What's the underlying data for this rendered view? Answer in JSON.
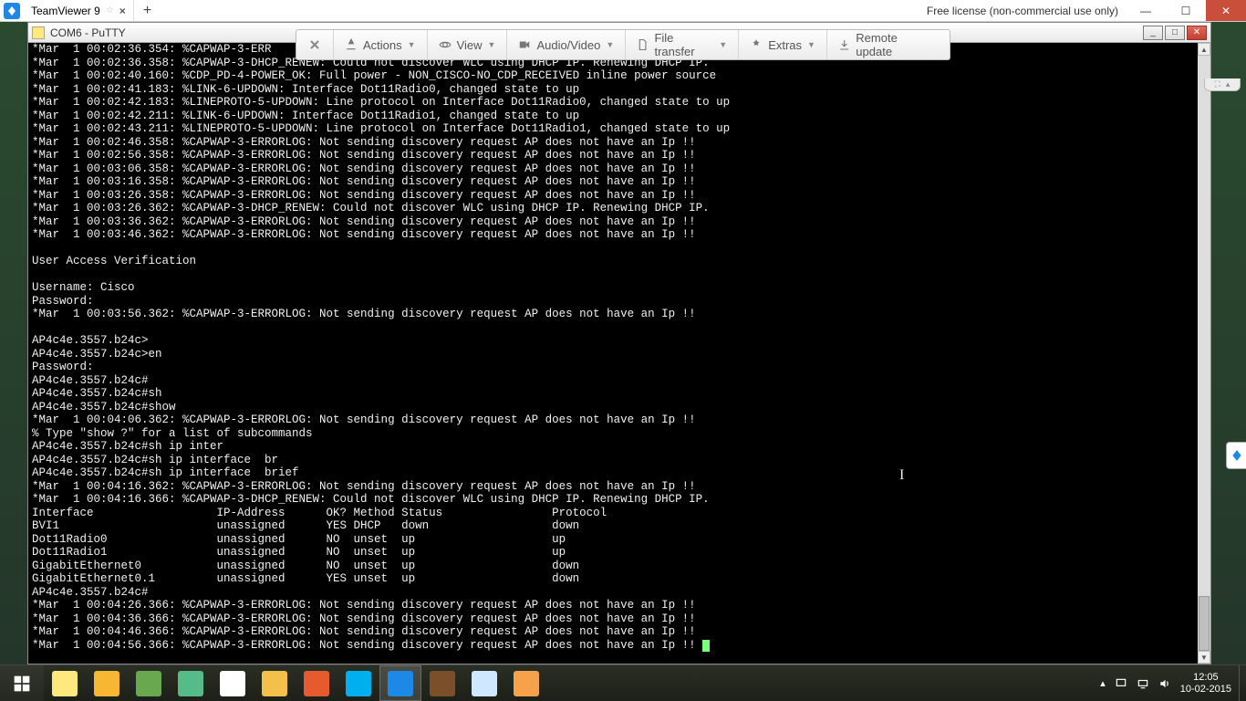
{
  "tv": {
    "tab_title": "TeamViewer 9",
    "license": "Free license (non-commercial use only)",
    "toolbar": {
      "actions": "Actions",
      "view": "View",
      "audiovideo": "Audio/Video",
      "filetransfer": "File transfer",
      "extras": "Extras",
      "remoteupdate": "Remote update"
    }
  },
  "putty": {
    "title": "COM6 - PuTTY"
  },
  "terminal_lines": [
    "*Mar  1 00:02:36.354: %CAPWAP-3-ERR",
    "*Mar  1 00:02:36.358: %CAPWAP-3-DHCP_RENEW: Could not discover WLC using DHCP IP. Renewing DHCP IP.",
    "*Mar  1 00:02:40.160: %CDP_PD-4-POWER_OK: Full power - NON_CISCO-NO_CDP_RECEIVED inline power source",
    "*Mar  1 00:02:41.183: %LINK-6-UPDOWN: Interface Dot11Radio0, changed state to up",
    "*Mar  1 00:02:42.183: %LINEPROTO-5-UPDOWN: Line protocol on Interface Dot11Radio0, changed state to up",
    "*Mar  1 00:02:42.211: %LINK-6-UPDOWN: Interface Dot11Radio1, changed state to up",
    "*Mar  1 00:02:43.211: %LINEPROTO-5-UPDOWN: Line protocol on Interface Dot11Radio1, changed state to up",
    "*Mar  1 00:02:46.358: %CAPWAP-3-ERRORLOG: Not sending discovery request AP does not have an Ip !!",
    "*Mar  1 00:02:56.358: %CAPWAP-3-ERRORLOG: Not sending discovery request AP does not have an Ip !!",
    "*Mar  1 00:03:06.358: %CAPWAP-3-ERRORLOG: Not sending discovery request AP does not have an Ip !!",
    "*Mar  1 00:03:16.358: %CAPWAP-3-ERRORLOG: Not sending discovery request AP does not have an Ip !!",
    "*Mar  1 00:03:26.358: %CAPWAP-3-ERRORLOG: Not sending discovery request AP does not have an Ip !!",
    "*Mar  1 00:03:26.362: %CAPWAP-3-DHCP_RENEW: Could not discover WLC using DHCP IP. Renewing DHCP IP.",
    "*Mar  1 00:03:36.362: %CAPWAP-3-ERRORLOG: Not sending discovery request AP does not have an Ip !!",
    "*Mar  1 00:03:46.362: %CAPWAP-3-ERRORLOG: Not sending discovery request AP does not have an Ip !!",
    "",
    "User Access Verification",
    "",
    "Username: Cisco",
    "Password:",
    "*Mar  1 00:03:56.362: %CAPWAP-3-ERRORLOG: Not sending discovery request AP does not have an Ip !!",
    "",
    "AP4c4e.3557.b24c>",
    "AP4c4e.3557.b24c>en",
    "Password:",
    "AP4c4e.3557.b24c#",
    "AP4c4e.3557.b24c#sh",
    "AP4c4e.3557.b24c#show",
    "*Mar  1 00:04:06.362: %CAPWAP-3-ERRORLOG: Not sending discovery request AP does not have an Ip !!",
    "% Type \"show ?\" for a list of subcommands",
    "AP4c4e.3557.b24c#sh ip inter",
    "AP4c4e.3557.b24c#sh ip interface  br",
    "AP4c4e.3557.b24c#sh ip interface  brief",
    "*Mar  1 00:04:16.362: %CAPWAP-3-ERRORLOG: Not sending discovery request AP does not have an Ip !!",
    "*Mar  1 00:04:16.366: %CAPWAP-3-DHCP_RENEW: Could not discover WLC using DHCP IP. Renewing DHCP IP.",
    "Interface                  IP-Address      OK? Method Status                Protocol",
    "BVI1                       unassigned      YES DHCP   down                  down",
    "Dot11Radio0                unassigned      NO  unset  up                    up",
    "Dot11Radio1                unassigned      NO  unset  up                    up",
    "GigabitEthernet0           unassigned      NO  unset  up                    down",
    "GigabitEthernet0.1         unassigned      YES unset  up                    down",
    "AP4c4e.3557.b24c#",
    "*Mar  1 00:04:26.366: %CAPWAP-3-ERRORLOG: Not sending discovery request AP does not have an Ip !!",
    "*Mar  1 00:04:36.366: %CAPWAP-3-ERRORLOG: Not sending discovery request AP does not have an Ip !!",
    "*Mar  1 00:04:46.366: %CAPWAP-3-ERRORLOG: Not sending discovery request AP does not have an Ip !!",
    "*Mar  1 00:04:56.366: %CAPWAP-3-ERRORLOG: Not sending discovery request AP does not have an Ip !! "
  ],
  "chart_data": {
    "type": "table",
    "title": "show ip interface brief",
    "columns": [
      "Interface",
      "IP-Address",
      "OK?",
      "Method",
      "Status",
      "Protocol"
    ],
    "rows": [
      [
        "BVI1",
        "unassigned",
        "YES",
        "DHCP",
        "down",
        "down"
      ],
      [
        "Dot11Radio0",
        "unassigned",
        "NO",
        "unset",
        "up",
        "up"
      ],
      [
        "Dot11Radio1",
        "unassigned",
        "NO",
        "unset",
        "up",
        "up"
      ],
      [
        "GigabitEthernet0",
        "unassigned",
        "NO",
        "unset",
        "up",
        "down"
      ],
      [
        "GigabitEthernet0.1",
        "unassigned",
        "YES",
        "unset",
        "up",
        "down"
      ]
    ]
  },
  "taskbar": {
    "items": [
      {
        "name": "putty",
        "color": "#ffe97f"
      },
      {
        "name": "outlook",
        "color": "#f7b733"
      },
      {
        "name": "folders",
        "color": "#6aa84f"
      },
      {
        "name": "winscp",
        "color": "#5b8"
      },
      {
        "name": "chrome",
        "color": "#fff"
      },
      {
        "name": "explorer",
        "color": "#f5c04a"
      },
      {
        "name": "firefox",
        "color": "#e55b2d"
      },
      {
        "name": "skype",
        "color": "#00aff0"
      },
      {
        "name": "teamviewer",
        "color": "#1e88e5"
      },
      {
        "name": "winrar",
        "color": "#7a4f2a"
      },
      {
        "name": "notepad",
        "color": "#cfe8ff"
      },
      {
        "name": "snagit",
        "color": "#f7a24a"
      }
    ],
    "time": "12:05",
    "date": "10-02-2015"
  }
}
